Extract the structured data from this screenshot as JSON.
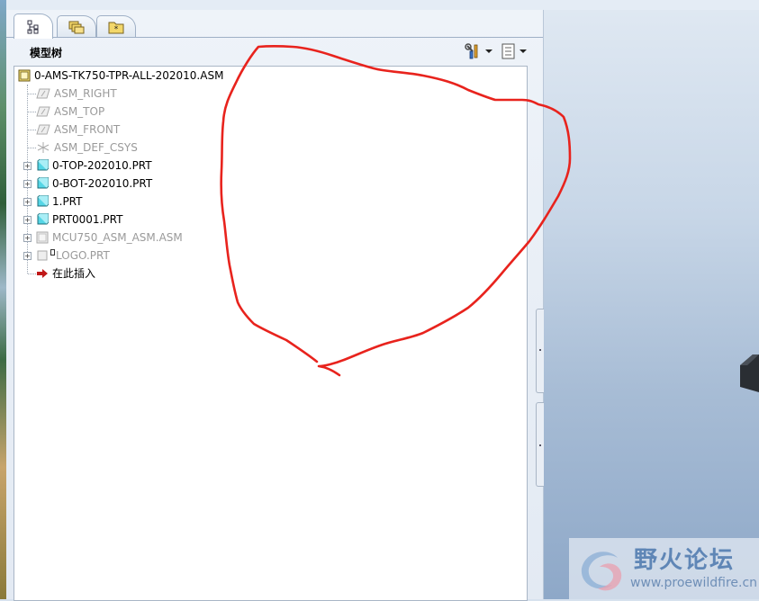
{
  "navigator": {
    "tabs": [
      {
        "name": "model-tree-tab",
        "icon": "model-tree-icon",
        "active": true
      },
      {
        "name": "folder-browser-tab",
        "icon": "folders-icon",
        "active": false
      },
      {
        "name": "favorites-tab",
        "icon": "favorites-icon",
        "active": false
      }
    ],
    "title": "模型树",
    "settings_icon": "tools-icon",
    "show_icon": "list-settings-icon"
  },
  "tree": {
    "root": "0-AMS-TK750-TPR-ALL-202010.ASM",
    "items": [
      {
        "label": "ASM_RIGHT",
        "icon": "datum-plane-icon",
        "dim": true,
        "expandable": false
      },
      {
        "label": "ASM_TOP",
        "icon": "datum-plane-icon",
        "dim": true,
        "expandable": false
      },
      {
        "label": "ASM_FRONT",
        "icon": "datum-plane-icon",
        "dim": true,
        "expandable": false
      },
      {
        "label": "ASM_DEF_CSYS",
        "icon": "csys-icon",
        "dim": true,
        "expandable": false
      },
      {
        "label": "0-TOP-202010.PRT",
        "icon": "part-icon",
        "dim": false,
        "expandable": true
      },
      {
        "label": "0-BOT-202010.PRT",
        "icon": "part-icon",
        "dim": false,
        "expandable": true
      },
      {
        "label": "1.PRT",
        "icon": "part-icon",
        "dim": false,
        "expandable": true
      },
      {
        "label": "PRT0001.PRT",
        "icon": "part-icon",
        "dim": false,
        "expandable": true
      },
      {
        "label": "MCU750_ASM_ASM.ASM",
        "icon": "assembly-icon",
        "dim": true,
        "expandable": true
      },
      {
        "label": "LOGO.PRT",
        "icon": "part-icon",
        "dim": true,
        "expandable": true
      },
      {
        "label": "在此插入",
        "icon": "insert-here-arrow-icon",
        "dim": false,
        "expandable": false
      }
    ]
  },
  "watermark": {
    "title": "野火论坛",
    "url": "www.proewildfire.cn"
  },
  "colors": {
    "annotation": "#e8231d",
    "part_fill": "#55d6e6",
    "insert_arrow": "#c01818"
  }
}
